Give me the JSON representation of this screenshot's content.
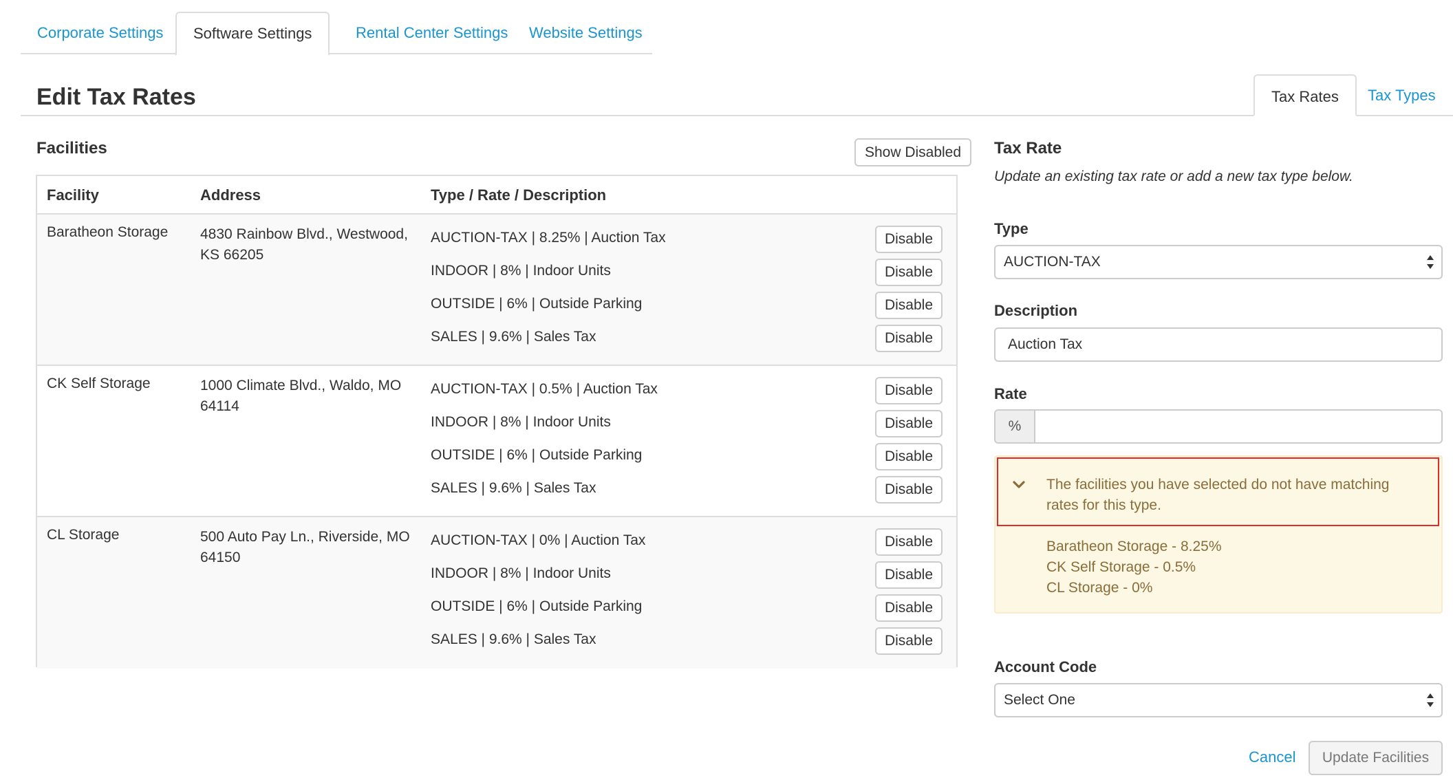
{
  "top_tabs": [
    {
      "label": "Corporate Settings",
      "active": false
    },
    {
      "label": "Software Settings",
      "active": true
    },
    {
      "label": "Rental Center Settings",
      "active": false
    },
    {
      "label": "Website Settings",
      "active": false
    }
  ],
  "page_title": "Edit Tax Rates",
  "right_tabs": [
    {
      "label": "Tax Rates",
      "active": true
    },
    {
      "label": "Tax Types",
      "active": false
    }
  ],
  "facilities": {
    "heading": "Facilities",
    "show_disabled_label": "Show Disabled",
    "columns": [
      "Facility",
      "Address",
      "Type / Rate / Description"
    ],
    "disable_label": "Disable",
    "rows": [
      {
        "name": "Baratheon Storage",
        "address": "4830 Rainbow Blvd., Westwood, KS 66205",
        "rates": [
          "AUCTION-TAX | 8.25% | Auction Tax",
          "INDOOR | 8% | Indoor Units",
          "OUTSIDE | 6% | Outside Parking",
          "SALES | 9.6% | Sales Tax"
        ]
      },
      {
        "name": "CK Self Storage",
        "address": "1000 Climate Blvd., Waldo, MO 64114",
        "rates": [
          "AUCTION-TAX | 0.5% | Auction Tax",
          "INDOOR | 8% | Indoor Units",
          "OUTSIDE | 6% | Outside Parking",
          "SALES | 9.6% | Sales Tax"
        ]
      },
      {
        "name": "CL Storage",
        "address": "500 Auto Pay Ln., Riverside, MO 64150",
        "rates": [
          "AUCTION-TAX | 0% | Auction Tax",
          "INDOOR | 8% | Indoor Units",
          "OUTSIDE | 6% | Outside Parking",
          "SALES | 9.6% | Sales Tax"
        ]
      }
    ]
  },
  "tax_rate_form": {
    "heading": "Tax Rate",
    "hint": "Update an existing tax rate or add a new tax type below.",
    "type_label": "Type",
    "type_value": "AUCTION-TAX",
    "description_label": "Description",
    "description_value": "Auction Tax",
    "rate_label": "Rate",
    "rate_addon": "%",
    "rate_value": "",
    "warning": {
      "message": "The facilities you have selected do not have matching rates for this type.",
      "items": [
        "Baratheon Storage - 8.25%",
        "CK Self Storage - 0.5%",
        "CL Storage - 0%"
      ],
      "icon": "chevron-down-icon",
      "background_color": "#fcf8e3",
      "text_color": "#8a6d3b",
      "highlight_color": "#e02b2b"
    },
    "account_code_label": "Account Code",
    "account_code_value": "Select One",
    "cancel_label": "Cancel",
    "update_label": "Update Facilities"
  },
  "colors": {
    "link": "#1a95d2",
    "text": "#333333",
    "border": "#dddddd"
  }
}
